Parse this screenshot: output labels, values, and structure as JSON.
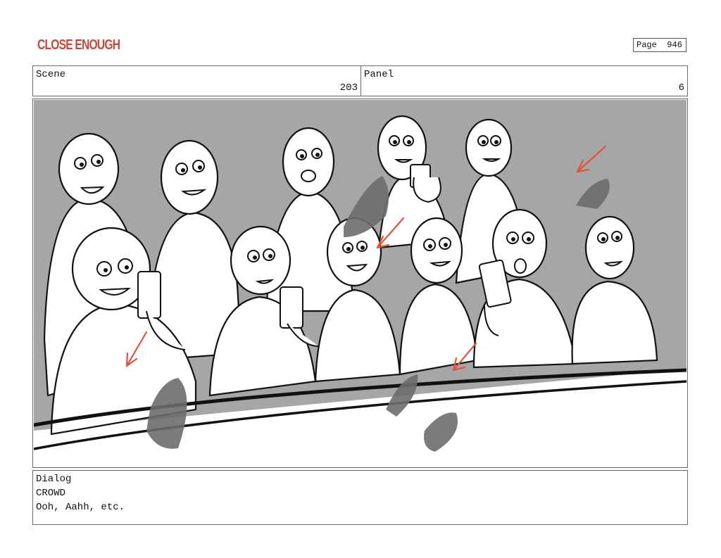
{
  "brand": {
    "logo_text": "CLOSE ENOUGH",
    "color": "#c9473a"
  },
  "page": {
    "label": "Page",
    "number": "946"
  },
  "header": {
    "scene_label": "Scene",
    "scene_value": "203",
    "panel_label": "Panel",
    "panel_value": "6"
  },
  "dialog": {
    "label": "Dialog",
    "character": "CROWD",
    "line": "Ooh, Aahh, etc."
  },
  "colors": {
    "background": "#a6a6a6",
    "annotation_arrow": "#e0533c",
    "debris": "#6d6d6d"
  }
}
